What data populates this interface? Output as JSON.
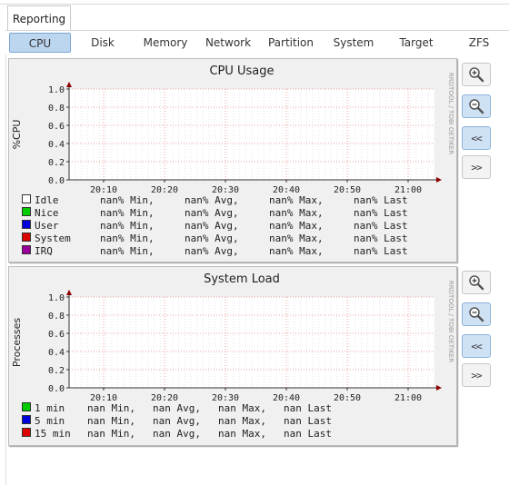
{
  "main_tabs": [
    {
      "label": "Reporting"
    }
  ],
  "sub_tabs": [
    {
      "label": "CPU",
      "active": true
    },
    {
      "label": "Disk"
    },
    {
      "label": "Memory"
    },
    {
      "label": "Network"
    },
    {
      "label": "Partition"
    },
    {
      "label": "System"
    },
    {
      "label": "Target"
    },
    {
      "label": "ZFS"
    }
  ],
  "graph_buttons": {
    "zoom_in_icon": "zoom-in-icon",
    "zoom_out_icon": "zoom-out-icon",
    "back_label": "<<",
    "forward_label": ">>"
  },
  "charts": [
    {
      "title": "CPU Usage",
      "ylabel": "%CPU",
      "side_label": "RRDTOOL / TOBI OETIKER",
      "yticks": [
        "1.0",
        "0.8",
        "0.6",
        "0.4",
        "0.2",
        "0.0"
      ],
      "xticks": [
        "20:10",
        "20:20",
        "20:30",
        "20:40",
        "20:50",
        "21:00"
      ],
      "legend": [
        {
          "swatch": "#ffffff",
          "name": "Idle",
          "min": "nan% Min,",
          "avg": "nan% Avg,",
          "max": "nan% Max,",
          "last": "nan% Last"
        },
        {
          "swatch": "#00cc00",
          "name": "Nice",
          "min": "nan% Min,",
          "avg": "nan% Avg,",
          "max": "nan% Max,",
          "last": "nan% Last"
        },
        {
          "swatch": "#0000dd",
          "name": "User",
          "min": "nan% Min,",
          "avg": "nan% Avg,",
          "max": "nan% Max,",
          "last": "nan% Last"
        },
        {
          "swatch": "#dd0000",
          "name": "System",
          "min": "nan% Min,",
          "avg": "nan% Avg,",
          "max": "nan% Max,",
          "last": "nan% Last"
        },
        {
          "swatch": "#990099",
          "name": "IRQ",
          "min": "nan% Min,",
          "avg": "nan% Avg,",
          "max": "nan% Max,",
          "last": "nan% Last"
        }
      ]
    },
    {
      "title": "System Load",
      "ylabel": "Processes",
      "side_label": "RRDTOOL / TOBI OETIKER",
      "yticks": [
        "1.0",
        "0.8",
        "0.6",
        "0.4",
        "0.2",
        "0.0"
      ],
      "xticks": [
        "20:10",
        "20:20",
        "20:30",
        "20:40",
        "20:50",
        "21:00"
      ],
      "legend": [
        {
          "swatch": "#00cc00",
          "name": "1 min",
          "min": "nan Min,",
          "avg": "nan Avg,",
          "max": "nan Max,",
          "last": "nan Last"
        },
        {
          "swatch": "#0000dd",
          "name": "5 min",
          "min": "nan Min,",
          "avg": "nan Avg,",
          "max": "nan Max,",
          "last": "nan Last"
        },
        {
          "swatch": "#dd0000",
          "name": "15 min",
          "min": "nan Min,",
          "avg": "nan Avg,",
          "max": "nan Max,",
          "last": "nan Last"
        }
      ]
    }
  ],
  "chart_data": [
    {
      "type": "area",
      "title": "CPU Usage",
      "ylabel": "%CPU",
      "xlabel": "",
      "ylim": [
        0,
        1.0
      ],
      "categories": [
        "20:10",
        "20:20",
        "20:30",
        "20:40",
        "20:50",
        "21:00"
      ],
      "grid": true,
      "series": [
        {
          "name": "Idle",
          "values": []
        },
        {
          "name": "Nice",
          "values": []
        },
        {
          "name": "User",
          "values": []
        },
        {
          "name": "System",
          "values": []
        },
        {
          "name": "IRQ",
          "values": []
        }
      ]
    },
    {
      "type": "line",
      "title": "System Load",
      "ylabel": "Processes",
      "xlabel": "",
      "ylim": [
        0,
        1.0
      ],
      "categories": [
        "20:10",
        "20:20",
        "20:30",
        "20:40",
        "20:50",
        "21:00"
      ],
      "grid": true,
      "series": [
        {
          "name": "1 min",
          "values": []
        },
        {
          "name": "5 min",
          "values": []
        },
        {
          "name": "15 min",
          "values": []
        }
      ]
    }
  ]
}
